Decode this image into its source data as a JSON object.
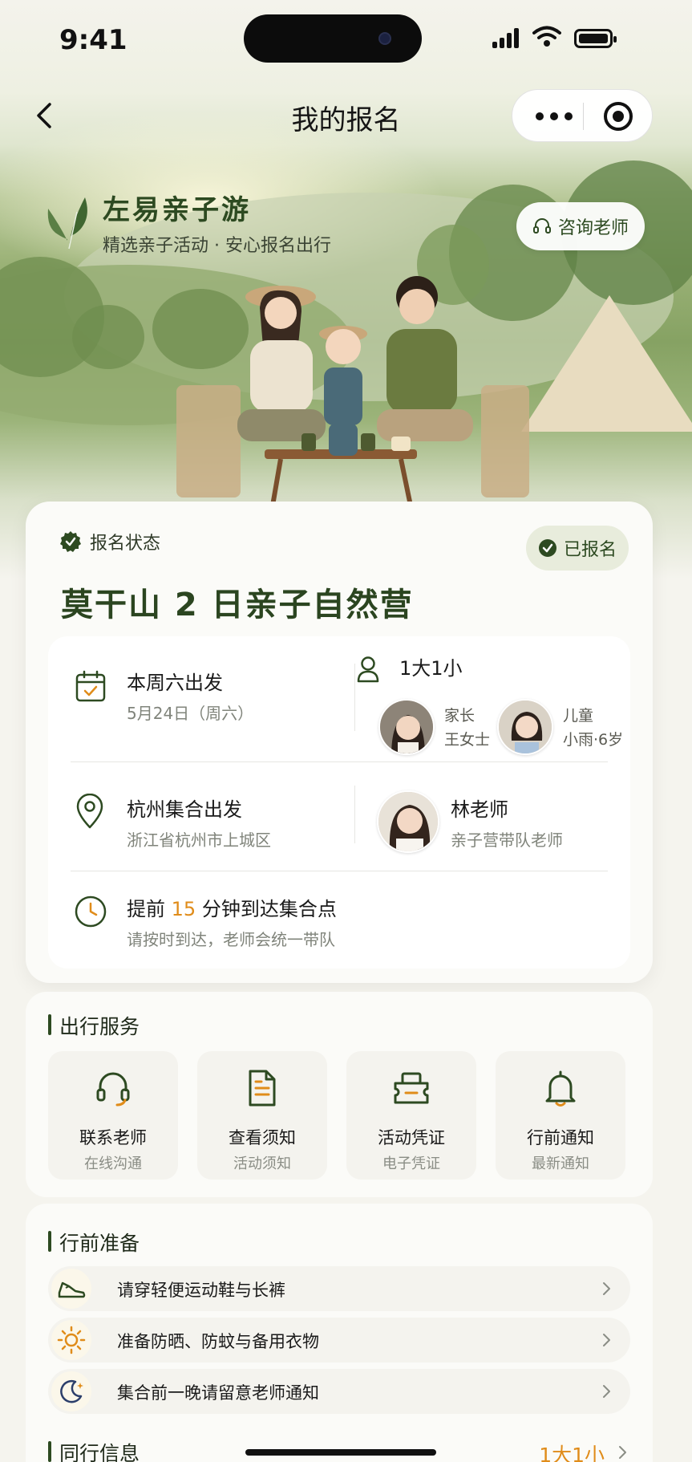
{
  "status_bar": {
    "time": "9:41"
  },
  "nav": {
    "title": "我的报名"
  },
  "brand": {
    "name": "左易亲子游",
    "slogan": "精选亲子活动 · 安心报名出行",
    "consult_label": "咨询老师"
  },
  "registration": {
    "status_label": "报名状态",
    "status_badge": "已报名",
    "event_title": "莫干山 2 日亲子自然营",
    "departure": {
      "title": "本周六出发",
      "date": "5月24日（周六）"
    },
    "party": {
      "title": "1大1小",
      "members": [
        {
          "role": "家长",
          "name": "王女士"
        },
        {
          "role": "儿童",
          "name": "小雨·6岁"
        }
      ]
    },
    "meeting": {
      "title": "杭州集合出发",
      "address": "浙江省杭州市上城区"
    },
    "teacher": {
      "name": "林老师",
      "role": "亲子营带队老师"
    },
    "arrival": {
      "prefix": "提前 ",
      "minutes": "15",
      "suffix": " 分钟到达集合点",
      "note": "请按时到达，老师会统一带队"
    }
  },
  "services": {
    "title": "出行服务",
    "items": [
      {
        "label": "联系老师",
        "sub": "在线沟通",
        "icon": "headset-icon"
      },
      {
        "label": "查看须知",
        "sub": "活动须知",
        "icon": "document-icon"
      },
      {
        "label": "活动凭证",
        "sub": "电子凭证",
        "icon": "ticket-icon"
      },
      {
        "label": "行前通知",
        "sub": "最新通知",
        "icon": "bell-icon"
      }
    ]
  },
  "preparation": {
    "title": "行前准备",
    "items": [
      {
        "text": "请穿轻便运动鞋与长裤",
        "icon": "shoe-icon"
      },
      {
        "text": "准备防晒、防蚊与备用衣物",
        "icon": "sun-icon"
      },
      {
        "text": "集合前一晚请留意老师通知",
        "icon": "moon-icon"
      }
    ]
  },
  "companions": {
    "title": "同行信息",
    "value": "1大1小"
  },
  "colors": {
    "primary": "#2d4a21",
    "accent": "#e08c1a",
    "background": "#f5f4ee"
  }
}
